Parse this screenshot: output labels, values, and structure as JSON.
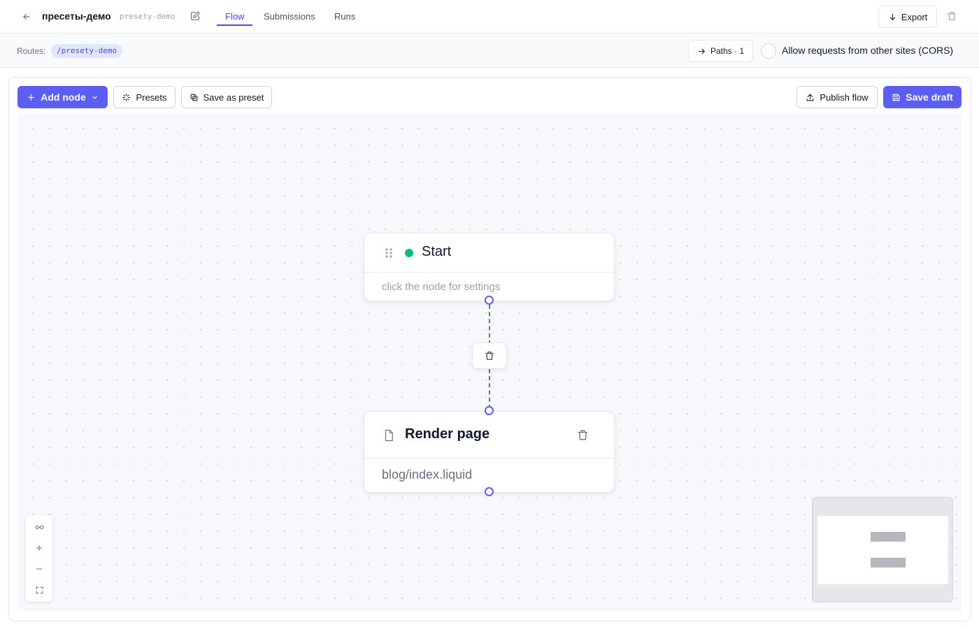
{
  "header": {
    "title": "пресеты-демо",
    "slug": "presety-demo",
    "tabs": [
      {
        "label": "Flow",
        "active": true
      },
      {
        "label": "Submissions",
        "active": false
      },
      {
        "label": "Runs",
        "active": false
      }
    ],
    "export_label": "Export"
  },
  "routes": {
    "label": "Routes:",
    "route": "/presety-demo",
    "paths_label": "Paths · 1",
    "cors_label": "Allow requests from other sites (CORS)",
    "cors_enabled": false
  },
  "toolbar": {
    "add_node_label": "Add node",
    "presets_label": "Presets",
    "save_preset_label": "Save as preset",
    "publish_label": "Publish flow",
    "save_draft_label": "Save draft"
  },
  "nodes": {
    "start": {
      "title": "Start",
      "hint": "click the node for settings",
      "status_color": "#10b981"
    },
    "render": {
      "title": "Render page",
      "template": "blog/index.liquid"
    }
  },
  "colors": {
    "accent": "#5b5ef0",
    "status": "#10b981"
  },
  "icons": {
    "back": "arrow-left-icon",
    "edit": "edit-icon",
    "export": "download-icon",
    "delete": "trash-icon",
    "paths": "arrow-right-icon",
    "add": "plus-icon",
    "dropdown": "chevron-down-icon",
    "presets": "sparkle-icon",
    "save_preset": "copy-icon",
    "publish": "upload-icon",
    "save_draft": "save-icon",
    "drag": "drag-handle-icon",
    "file": "file-icon",
    "link": "link-icon",
    "zoom_in": "zoom-in-icon",
    "zoom_out": "zoom-out-icon",
    "fit_view": "fit-view-icon"
  }
}
